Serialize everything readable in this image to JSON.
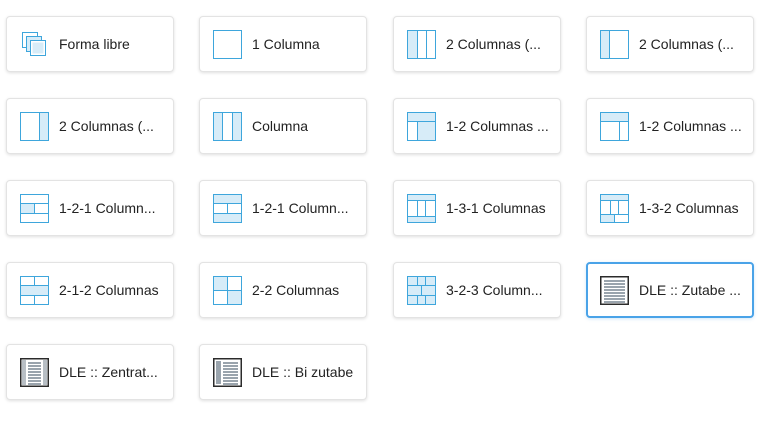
{
  "colors": {
    "icon_stroke": "#3ea6dc",
    "icon_fill": "#d7ecf8",
    "dle_border": "#2b2b2b",
    "dle_fill": "#9aa4ad",
    "selected_border": "#4aa3e8"
  },
  "layouts": [
    {
      "label": "Forma libre",
      "icon": "free-form-icon"
    },
    {
      "label": "1 Columna",
      "icon": "one-column-icon"
    },
    {
      "label": "2 Columnas (...",
      "icon": "two-columns-left-icon"
    },
    {
      "label": "2 Columnas (...",
      "icon": "two-columns-narrow-left-icon"
    },
    {
      "label": "2 Columnas (...",
      "icon": "two-columns-right-icon"
    },
    {
      "label": "Columna",
      "icon": "three-columns-icon"
    },
    {
      "label": "1-2 Columnas ...",
      "icon": "one-two-columns-icon"
    },
    {
      "label": "1-2 Columnas ...",
      "icon": "one-two-columns-alt-icon"
    },
    {
      "label": "1-2-1 Column...",
      "icon": "one-two-one-columns-icon"
    },
    {
      "label": "1-2-1 Column...",
      "icon": "one-two-one-columns-alt-icon"
    },
    {
      "label": "1-3-1 Columnas",
      "icon": "one-three-one-columns-icon"
    },
    {
      "label": "1-3-2 Columnas",
      "icon": "one-three-two-columns-icon"
    },
    {
      "label": "2-1-2 Columnas",
      "icon": "two-one-two-columns-icon"
    },
    {
      "label": "2-2 Columnas",
      "icon": "two-two-columns-icon"
    },
    {
      "label": "3-2-3 Column...",
      "icon": "three-two-three-columns-icon"
    },
    {
      "label": "DLE :: Zutabe ...",
      "icon": "dle-zutabe-icon",
      "selected": true
    },
    {
      "label": "DLE :: Zentrat...",
      "icon": "dle-zentratu-icon"
    },
    {
      "label": "DLE :: Bi zutabe",
      "icon": "dle-bi-zutabe-icon"
    }
  ]
}
